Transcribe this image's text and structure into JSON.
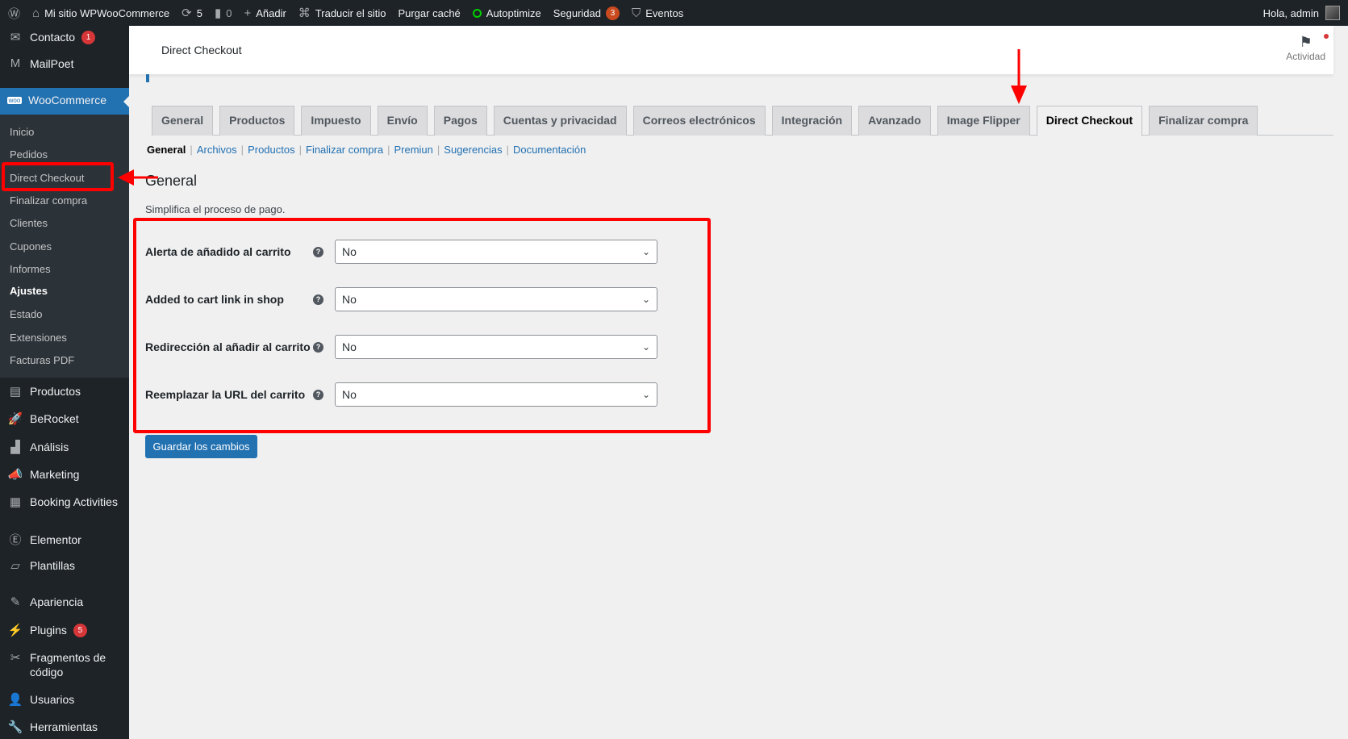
{
  "adminbar": {
    "site_name": "Mi sitio WPWooCommerce",
    "updates_count": "5",
    "comments_count": "0",
    "add_new": "Añadir",
    "translate": "Traducir el sitio",
    "purge_cache": "Purgar caché",
    "autoptimize": "Autoptimize",
    "security": "Seguridad",
    "security_count": "3",
    "events": "Eventos",
    "greeting": "Hola, admin"
  },
  "sidebar": {
    "contacto": "Contacto",
    "contacto_badge": "1",
    "mailpoet": "MailPoet",
    "woocommerce": "WooCommerce",
    "woo_sub": [
      "Inicio",
      "Pedidos",
      "Direct Checkout",
      "Finalizar compra",
      "Clientes",
      "Cupones",
      "Informes",
      "Ajustes",
      "Estado",
      "Extensiones",
      "Facturas PDF"
    ],
    "productos": "Productos",
    "berocket": "BeRocket",
    "analisis": "Análisis",
    "marketing": "Marketing",
    "booking": "Booking Activities",
    "elementor": "Elementor",
    "plantillas": "Plantillas",
    "apariencia": "Apariencia",
    "plugins": "Plugins",
    "plugins_badge": "5",
    "fragmentos": "Fragmentos de código",
    "usuarios": "Usuarios",
    "herramientas": "Herramientas"
  },
  "header": {
    "title": "Direct Checkout",
    "activity": "Actividad"
  },
  "tabs": [
    "General",
    "Productos",
    "Impuesto",
    "Envío",
    "Pagos",
    "Cuentas y privacidad",
    "Correos electrónicos",
    "Integración",
    "Avanzado",
    "Image Flipper",
    "Direct Checkout",
    "Finalizar compra"
  ],
  "active_tab": "Direct Checkout",
  "subnav": [
    "General",
    "Archivos",
    "Productos",
    "Finalizar compra",
    "Premiun",
    "Sugerencias",
    "Documentación"
  ],
  "section": {
    "title": "General",
    "description": "Simplifica el proceso de pago."
  },
  "fields": [
    {
      "label": "Alerta de añadido al carrito",
      "value": "No"
    },
    {
      "label": "Added to cart link in shop",
      "value": "No"
    },
    {
      "label": "Redirección al añadir al carrito",
      "value": "No"
    },
    {
      "label": "Reemplazar la URL del carrito",
      "value": "No"
    }
  ],
  "save_label": "Guardar los cambios",
  "colors": {
    "accent": "#2271b1",
    "annotation": "#ff0000",
    "sidebar": "#1d2327"
  }
}
